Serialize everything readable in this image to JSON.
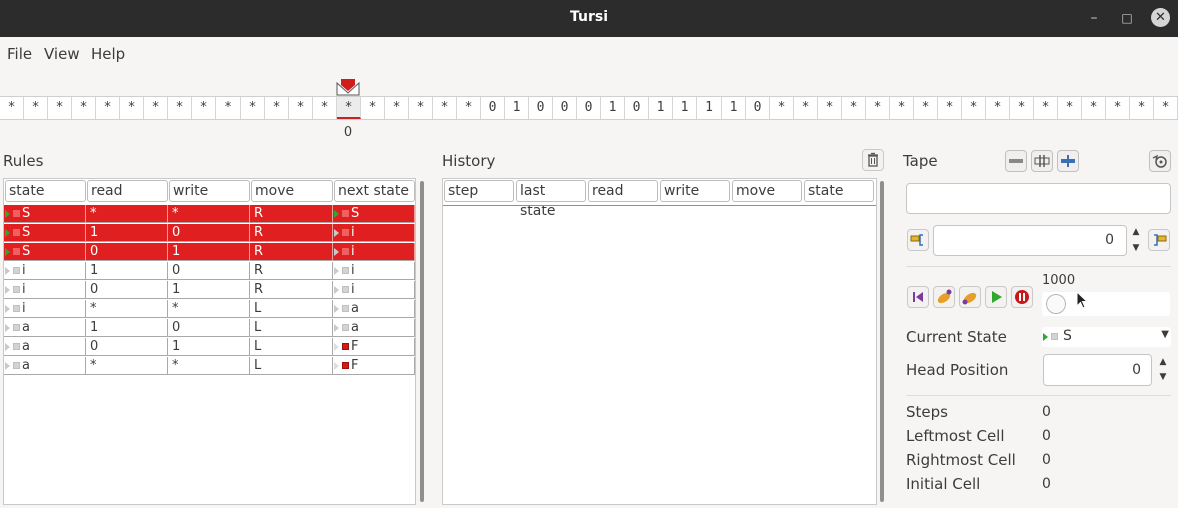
{
  "window": {
    "title": "Tursi",
    "minimize": "–",
    "maximize": "□",
    "close": "✕"
  },
  "menu": [
    "File",
    "View",
    "Help"
  ],
  "tape": {
    "cells": [
      "*",
      "*",
      "*",
      "*",
      "*",
      "*",
      "*",
      "*",
      "*",
      "*",
      "*",
      "*",
      "*",
      "*",
      "*",
      "*",
      "*",
      "*",
      "*",
      "*",
      "0",
      "1",
      "0",
      "0",
      "0",
      "1",
      "0",
      "1",
      "1",
      "1",
      "1",
      "0",
      "*",
      "*",
      "*",
      "*",
      "*",
      "*",
      "*",
      "*",
      "*",
      "*",
      "*",
      "*",
      "*",
      "*",
      "*",
      "*",
      "*"
    ],
    "head_cell": 14,
    "head_index": "0"
  },
  "rules": {
    "label": "Rules",
    "columns": [
      "state",
      "read",
      "write",
      "move",
      "next state"
    ],
    "rows": [
      {
        "state": "S",
        "read": "*",
        "write": "*",
        "move": "R",
        "next": "S",
        "active": true,
        "state_icon": "start",
        "next_icon": "start"
      },
      {
        "state": "S",
        "read": "1",
        "write": "0",
        "move": "R",
        "next": "i",
        "active": true,
        "state_icon": "start",
        "next_icon": "normal"
      },
      {
        "state": "S",
        "read": "0",
        "write": "1",
        "move": "R",
        "next": "i",
        "active": true,
        "state_icon": "start",
        "next_icon": "normal"
      },
      {
        "state": "i",
        "read": "1",
        "write": "0",
        "move": "R",
        "next": "i",
        "active": false,
        "state_icon": "normal",
        "next_icon": "normal"
      },
      {
        "state": "i",
        "read": "0",
        "write": "1",
        "move": "R",
        "next": "i",
        "active": false,
        "state_icon": "normal",
        "next_icon": "normal"
      },
      {
        "state": "i",
        "read": "*",
        "write": "*",
        "move": "L",
        "next": "a",
        "active": false,
        "state_icon": "normal",
        "next_icon": "normal"
      },
      {
        "state": "a",
        "read": "1",
        "write": "0",
        "move": "L",
        "next": "a",
        "active": false,
        "state_icon": "normal",
        "next_icon": "normal"
      },
      {
        "state": "a",
        "read": "0",
        "write": "1",
        "move": "L",
        "next": "F",
        "active": false,
        "state_icon": "normal",
        "next_icon": "final"
      },
      {
        "state": "a",
        "read": "*",
        "write": "*",
        "move": "L",
        "next": "F",
        "active": false,
        "state_icon": "normal",
        "next_icon": "final"
      }
    ]
  },
  "history": {
    "label": "History",
    "columns": [
      "step",
      "last state",
      "read",
      "write",
      "move",
      "state"
    ],
    "clear_icon": "trash-icon"
  },
  "tape_panel": {
    "label": "Tape",
    "input_value": "",
    "position_value": "0",
    "speed": "1000"
  },
  "status": {
    "current_state_label": "Current State",
    "current_state": "S",
    "head_position_label": "Head Position",
    "head_position": "0",
    "steps_label": "Steps",
    "steps": "0",
    "leftmost_label": "Leftmost Cell",
    "leftmost": "0",
    "rightmost_label": "Rightmost Cell",
    "rightmost": "0",
    "initial_label": "Initial Cell",
    "initial": "0"
  },
  "colors": {
    "active_row": "#e02020",
    "start": "#2ea82e",
    "final": "#d11c1c",
    "titlebar": "#2c2c2c"
  }
}
